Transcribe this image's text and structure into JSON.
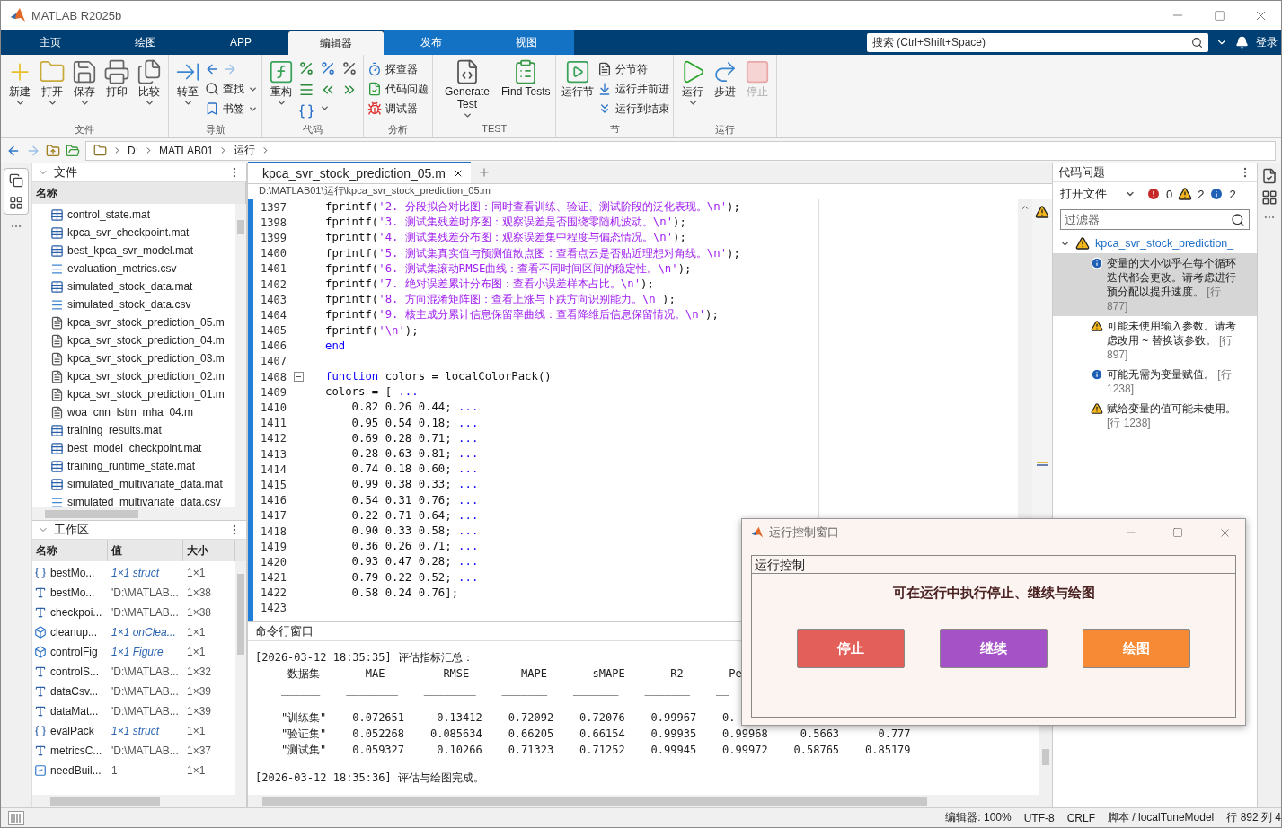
{
  "window": {
    "title": "MATLAB R2025b"
  },
  "tabs": [
    {
      "label": "主页",
      "selected": false
    },
    {
      "label": "绘图",
      "selected": false
    },
    {
      "label": "APP",
      "selected": false
    },
    {
      "label": "编辑器",
      "selected": true
    },
    {
      "label": "发布",
      "selected": false
    },
    {
      "label": "视图",
      "selected": false
    }
  ],
  "search": {
    "placeholder": "搜索 (Ctrl+Shift+Space)"
  },
  "login": "登录",
  "ribbon": [
    {
      "label": "文件",
      "columns": [
        [
          {
            "kind": "large",
            "label": "新建",
            "dropdown": true,
            "disabled": false
          }
        ],
        [
          {
            "kind": "large",
            "label": "打开",
            "dropdown": true,
            "disabled": false
          }
        ],
        [
          {
            "kind": "large",
            "label": "保存",
            "dropdown": true,
            "disabled": false
          }
        ],
        [
          {
            "kind": "large",
            "label": "打印",
            "dropdown": false,
            "disabled": false
          }
        ],
        [
          {
            "kind": "large",
            "label": "比较",
            "dropdown": true,
            "disabled": false
          }
        ]
      ]
    },
    {
      "label": "导航",
      "columns": [
        [
          {
            "kind": "large",
            "label": "转至",
            "dropdown": true,
            "disabled": false
          }
        ],
        [
          {
            "kind": "nav"
          },
          {
            "kind": "small",
            "label": "查找",
            "dropdown": true,
            "disabled": false
          },
          {
            "kind": "small",
            "label": "书签",
            "dropdown": true,
            "disabled": false
          }
        ]
      ]
    },
    {
      "label": "代码",
      "columns": [
        [
          {
            "kind": "large",
            "label": "重构",
            "dropdown": true,
            "disabled": false
          }
        ],
        [
          {
            "kind": "icon-grid"
          }
        ]
      ]
    },
    {
      "label": "分析",
      "columns": [
        [
          {
            "kind": "small",
            "label": "探查器",
            "dropdown": false,
            "disabled": false
          },
          {
            "kind": "small",
            "label": "代码问题",
            "dropdown": false,
            "disabled": false
          },
          {
            "kind": "small",
            "label": "调试器",
            "dropdown": false,
            "disabled": false
          }
        ]
      ]
    },
    {
      "label": "TEST",
      "columns": [
        [
          {
            "kind": "large",
            "label": "Generate Test",
            "dropdown": true,
            "disabled": false
          }
        ],
        [
          {
            "kind": "large",
            "label": "Find Tests",
            "dropdown": false,
            "disabled": false
          }
        ]
      ]
    },
    {
      "label": "节",
      "columns": [
        [
          {
            "kind": "large",
            "label": "运行节",
            "dropdown": false,
            "disabled": false
          }
        ],
        [
          {
            "kind": "small",
            "label": "分节符",
            "dropdown": false,
            "disabled": false
          },
          {
            "kind": "small",
            "label": "运行并前进",
            "dropdown": false,
            "disabled": false
          },
          {
            "kind": "small",
            "label": "运行到结束",
            "dropdown": false,
            "disabled": false
          }
        ]
      ]
    },
    {
      "label": "运行",
      "columns": [
        [
          {
            "kind": "large",
            "label": "运行",
            "dropdown": true,
            "disabled": false
          }
        ],
        [
          {
            "kind": "large",
            "label": "步进",
            "dropdown": false,
            "disabled": false
          }
        ],
        [
          {
            "kind": "large",
            "label": "停止",
            "dropdown": false,
            "disabled": true
          }
        ]
      ]
    }
  ],
  "address": [
    "D:",
    "MATLAB01",
    "运行"
  ],
  "files": {
    "title": "文件",
    "column": "名称",
    "items": [
      {
        "name": "control_state.mat",
        "kind": "mat"
      },
      {
        "name": "kpca_svr_checkpoint.mat",
        "kind": "mat"
      },
      {
        "name": "best_kpca_svr_model.mat",
        "kind": "mat"
      },
      {
        "name": "evaluation_metrics.csv",
        "kind": "csv"
      },
      {
        "name": "simulated_stock_data.mat",
        "kind": "mat"
      },
      {
        "name": "simulated_stock_data.csv",
        "kind": "csv"
      },
      {
        "name": "kpca_svr_stock_prediction_05.m",
        "kind": "m"
      },
      {
        "name": "kpca_svr_stock_prediction_04.m",
        "kind": "m"
      },
      {
        "name": "kpca_svr_stock_prediction_03.m",
        "kind": "m"
      },
      {
        "name": "kpca_svr_stock_prediction_02.m",
        "kind": "m"
      },
      {
        "name": "kpca_svr_stock_prediction_01.m",
        "kind": "m"
      },
      {
        "name": "woa_cnn_lstm_mha_04.m",
        "kind": "m"
      },
      {
        "name": "training_results.mat",
        "kind": "mat"
      },
      {
        "name": "best_model_checkpoint.mat",
        "kind": "mat"
      },
      {
        "name": "training_runtime_state.mat",
        "kind": "mat"
      },
      {
        "name": "simulated_multivariate_data.mat",
        "kind": "mat"
      },
      {
        "name": "simulated_multivariate_data.csv",
        "kind": "csv"
      }
    ]
  },
  "workspace": {
    "title": "工作区",
    "columns": [
      "名称",
      "值",
      "大小"
    ],
    "rows": [
      {
        "name": "bestMo...",
        "value": "1×1 struct",
        "size": "1×1",
        "kind": "struct"
      },
      {
        "name": "bestMo...",
        "value": "'D:\\MATLAB...",
        "size": "1×38",
        "kind": "char"
      },
      {
        "name": "checkpoi...",
        "value": "'D:\\MATLAB...",
        "size": "1×38",
        "kind": "char"
      },
      {
        "name": "cleanup...",
        "value": "1×1 onClea...",
        "size": "1×1",
        "kind": "object"
      },
      {
        "name": "controlFig",
        "value": "1×1 Figure",
        "size": "1×1",
        "kind": "object"
      },
      {
        "name": "controlS...",
        "value": "'D:\\MATLAB...",
        "size": "1×32",
        "kind": "char"
      },
      {
        "name": "dataCsv...",
        "value": "'D:\\MATLAB...",
        "size": "1×39",
        "kind": "char"
      },
      {
        "name": "dataMat...",
        "value": "'D:\\MATLAB...",
        "size": "1×39",
        "kind": "char"
      },
      {
        "name": "evalPack",
        "value": "1×1 struct",
        "size": "1×1",
        "kind": "struct"
      },
      {
        "name": "metricsC...",
        "value": "'D:\\MATLAB...",
        "size": "1×37",
        "kind": "char"
      },
      {
        "name": "needBuil...",
        "value": "1",
        "size": "1×1",
        "kind": "logical"
      }
    ]
  },
  "editor": {
    "tabs": [
      {
        "label": "kpca_svr_stock_prediction_05.m",
        "selected": true
      }
    ],
    "path": "D:\\MATLAB01\\运行\\kpca_svr_stock_prediction_05.m",
    "lines": [
      {
        "number": "1397",
        "fold": false,
        "code": [
          {
            "kind": "plain",
            "text": "fprintf("
          },
          {
            "kind": "string",
            "text": "'2. 分段拟合对比图：同时查看训练、验证、测试阶段的泛化表现。\\n'"
          },
          {
            "kind": "plain",
            "text": ");"
          }
        ]
      },
      {
        "number": "1398",
        "fold": false,
        "code": [
          {
            "kind": "plain",
            "text": "fprintf("
          },
          {
            "kind": "string",
            "text": "'3. 测试集残差时序图：观察误差是否围绕零随机波动。\\n'"
          },
          {
            "kind": "plain",
            "text": ");"
          }
        ]
      },
      {
        "number": "1399",
        "fold": false,
        "code": [
          {
            "kind": "plain",
            "text": "fprintf("
          },
          {
            "kind": "string",
            "text": "'4. 测试集残差分布图：观察误差集中程度与偏态情况。\\n'"
          },
          {
            "kind": "plain",
            "text": ");"
          }
        ]
      },
      {
        "number": "1400",
        "fold": false,
        "code": [
          {
            "kind": "plain",
            "text": "fprintf("
          },
          {
            "kind": "string",
            "text": "'5. 测试集真实值与预测值散点图：查看点云是否贴近理想对角线。\\n'"
          },
          {
            "kind": "plain",
            "text": ");"
          }
        ]
      },
      {
        "number": "1401",
        "fold": false,
        "code": [
          {
            "kind": "plain",
            "text": "fprintf("
          },
          {
            "kind": "string",
            "text": "'6. 测试集滚动RMSE曲线：查看不同时间区间的稳定性。\\n'"
          },
          {
            "kind": "plain",
            "text": ");"
          }
        ]
      },
      {
        "number": "1402",
        "fold": false,
        "code": [
          {
            "kind": "plain",
            "text": "fprintf("
          },
          {
            "kind": "string",
            "text": "'7. 绝对误差累计分布图：查看小误差样本占比。\\n'"
          },
          {
            "kind": "plain",
            "text": ");"
          }
        ]
      },
      {
        "number": "1403",
        "fold": false,
        "code": [
          {
            "kind": "plain",
            "text": "fprintf("
          },
          {
            "kind": "string",
            "text": "'8. 方向混淆矩阵图：查看上涨与下跌方向识别能力。\\n'"
          },
          {
            "kind": "plain",
            "text": ");"
          }
        ]
      },
      {
        "number": "1404",
        "fold": false,
        "code": [
          {
            "kind": "plain",
            "text": "fprintf("
          },
          {
            "kind": "string",
            "text": "'9. 核主成分累计信息保留率曲线：查看降维后信息保留情况。\\n'"
          },
          {
            "kind": "plain",
            "text": ");"
          }
        ]
      },
      {
        "number": "1405",
        "fold": false,
        "code": [
          {
            "kind": "plain",
            "text": "fprintf("
          },
          {
            "kind": "string",
            "text": "'\\n'"
          },
          {
            "kind": "plain",
            "text": ");"
          }
        ]
      },
      {
        "number": "1406",
        "fold": false,
        "code": [
          {
            "kind": "keyword",
            "text": "end"
          }
        ]
      },
      {
        "number": "1407",
        "fold": false
      },
      {
        "number": "1408",
        "fold": true,
        "code": [
          {
            "kind": "keyword",
            "text": "function"
          },
          {
            "kind": "plain",
            "text": " colors = localColorPack()"
          }
        ]
      },
      {
        "number": "1409",
        "fold": false,
        "code": [
          {
            "kind": "plain",
            "text": "colors = [ "
          },
          {
            "kind": "keyword",
            "text": "..."
          }
        ]
      },
      {
        "number": "1410",
        "fold": false,
        "code": [
          {
            "kind": "plain",
            "text": "    0.82 0.26 0.44; "
          },
          {
            "kind": "keyword",
            "text": "..."
          }
        ]
      },
      {
        "number": "1411",
        "fold": false,
        "code": [
          {
            "kind": "plain",
            "text": "    0.95 0.54 0.18; "
          },
          {
            "kind": "keyword",
            "text": "..."
          }
        ]
      },
      {
        "number": "1412",
        "fold": false,
        "code": [
          {
            "kind": "plain",
            "text": "    0.69 0.28 0.71; "
          },
          {
            "kind": "keyword",
            "text": "..."
          }
        ]
      },
      {
        "number": "1413",
        "fold": false,
        "code": [
          {
            "kind": "plain",
            "text": "    0.28 0.63 0.81; "
          },
          {
            "kind": "keyword",
            "text": "..."
          }
        ]
      },
      {
        "number": "1414",
        "fold": false,
        "code": [
          {
            "kind": "plain",
            "text": "    0.74 0.18 0.60; "
          },
          {
            "kind": "keyword",
            "text": "..."
          }
        ]
      },
      {
        "number": "1415",
        "fold": false,
        "code": [
          {
            "kind": "plain",
            "text": "    0.99 0.38 0.33; "
          },
          {
            "kind": "keyword",
            "text": "..."
          }
        ]
      },
      {
        "number": "1416",
        "fold": false,
        "code": [
          {
            "kind": "plain",
            "text": "    0.54 0.31 0.76; "
          },
          {
            "kind": "keyword",
            "text": "..."
          }
        ]
      },
      {
        "number": "1417",
        "fold": false,
        "code": [
          {
            "kind": "plain",
            "text": "    0.22 0.71 0.64; "
          },
          {
            "kind": "keyword",
            "text": "..."
          }
        ]
      },
      {
        "number": "1418",
        "fold": false,
        "code": [
          {
            "kind": "plain",
            "text": "    0.90 0.33 0.58; "
          },
          {
            "kind": "keyword",
            "text": "..."
          }
        ]
      },
      {
        "number": "1419",
        "fold": false,
        "code": [
          {
            "kind": "plain",
            "text": "    0.36 0.26 0.71; "
          },
          {
            "kind": "keyword",
            "text": "..."
          }
        ]
      },
      {
        "number": "1420",
        "fold": false,
        "code": [
          {
            "kind": "plain",
            "text": "    0.93 0.47 0.28; "
          },
          {
            "kind": "keyword",
            "text": "..."
          }
        ]
      },
      {
        "number": "1421",
        "fold": false,
        "code": [
          {
            "kind": "plain",
            "text": "    0.79 0.22 0.52; "
          },
          {
            "kind": "keyword",
            "text": "..."
          }
        ]
      },
      {
        "number": "1422",
        "fold": false,
        "code": [
          {
            "kind": "plain",
            "text": "    0.58 0.24 0.76];"
          }
        ]
      },
      {
        "number": "1423",
        "fold": false
      }
    ]
  },
  "command_window": {
    "title": "命令行窗口",
    "blocks": [
      [
        "[2026-03-12 18:35:35] 评估指标汇总：",
        "     数据集       MAE         RMSE        MAPE       sMAPE       R2       Pe",
        "    ______    ________    ________    _______    _______    _______    __"
      ],
      [
        "    \"训练集\"    0.072651     0.13412    0.72092    0.72076    0.99967    0.",
        "    \"验证集\"    0.052268    0.085634    0.66205    0.66154    0.99935    0.99968     0.5663      0.777",
        "    \"测试集\"    0.059327     0.10266    0.71323    0.71252    0.99945    0.99972    0.58765    0.85179"
      ],
      [
        "[2026-03-12 18:35:36] 评估与绘图完成。"
      ]
    ]
  },
  "code_issues": {
    "title": "代码问题",
    "scope": "打开文件",
    "counts": {
      "errors": "0",
      "warnings": "2",
      "info": "2"
    },
    "filter_placeholder": "过滤器",
    "file": {
      "name": "kpca_svr_stock_prediction_",
      "expanded": true,
      "issues": [
        {
          "kind": "info",
          "text": "变量的大小似乎在每个循环迭代都会更改。请考虑进行预分配以提升速度。",
          "line": "[行 877]",
          "selected": true
        },
        {
          "kind": "warning",
          "text": "可能未使用输入参数。请考虑改用 ~ 替换该参数。",
          "line": "[行 897]",
          "selected": false
        },
        {
          "kind": "info",
          "text": "可能无需为变量赋值。",
          "line": "[行 1238]",
          "selected": false
        },
        {
          "kind": "warning",
          "text": "赋给变量的值可能未使用。",
          "line": "[行 1238]",
          "selected": false
        }
      ]
    }
  },
  "dialog": {
    "title": "运行控制窗口",
    "panel_title": "运行控制",
    "message": "可在运行中执行停止、继续与绘图",
    "buttons": [
      {
        "label": "停止",
        "color": "#e3605a"
      },
      {
        "label": "继续",
        "color": "#a552c6"
      },
      {
        "label": "绘图",
        "color": "#f78a35"
      }
    ]
  },
  "status_bar": [
    "编辑器: 100%",
    "UTF-8",
    "CRLF",
    "脚本 / localTuneModel",
    "行 892  列 4"
  ]
}
